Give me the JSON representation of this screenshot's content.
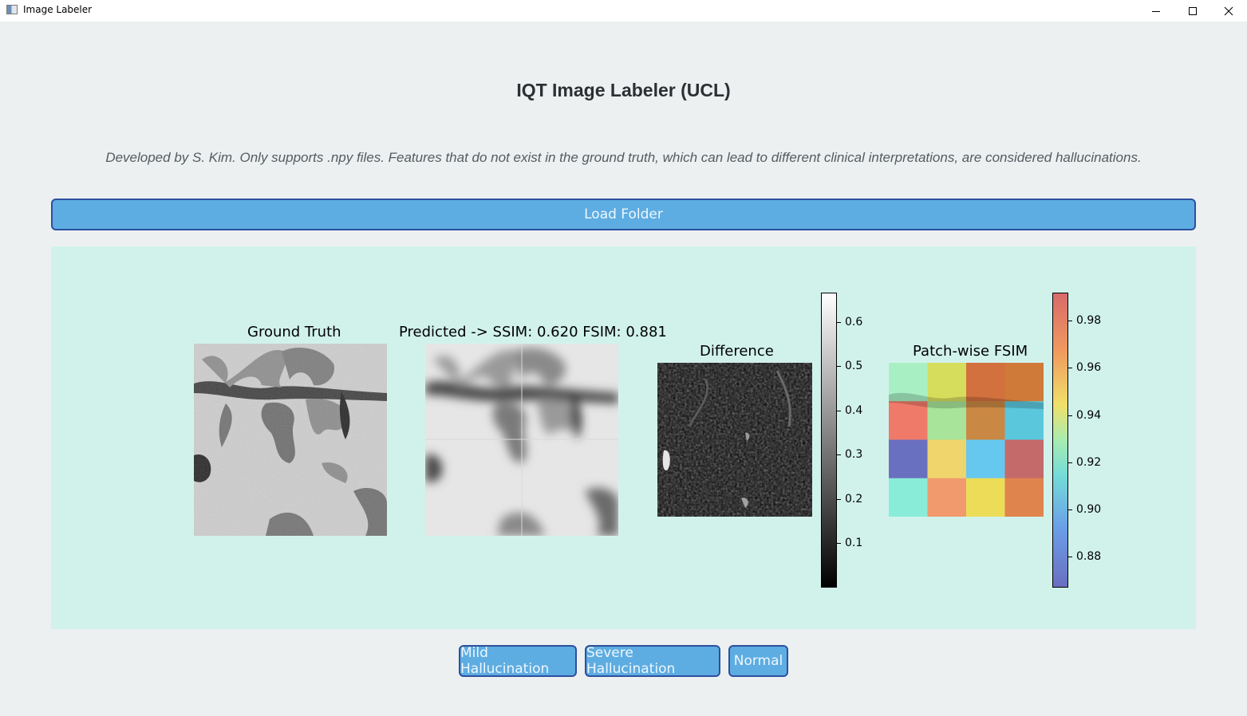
{
  "window": {
    "title": "Image Labeler",
    "controls": [
      "minimize",
      "maximize",
      "close"
    ]
  },
  "header": {
    "title": "IQT Image Labeler (UCL)",
    "subtitle": "Developed by S. Kim. Only supports .npy files. Features that do not exist in the ground truth, which can lead to different clinical interpretations, are considered hallucinations."
  },
  "toolbar": {
    "load_label": "Load Folder"
  },
  "figure": {
    "ground_truth_title": "Ground Truth",
    "predicted_title": "Predicted -> SSIM: 0.620 FSIM: 0.881",
    "difference_title": "Difference",
    "fsim_title": "Patch-wise FSIM",
    "difference_colorbar": {
      "colormap": "gray",
      "ticks": [
        "0.1",
        "0.2",
        "0.3",
        "0.4",
        "0.5",
        "0.6"
      ]
    },
    "fsim_colorbar": {
      "colormap": "coolwarm-like",
      "ticks": [
        "0.88",
        "0.90",
        "0.92",
        "0.94",
        "0.96",
        "0.98"
      ]
    },
    "fsim_patch_colors": [
      [
        "#a8f0c4",
        "#d6dc5c",
        "#d2703e",
        "#d07a3a"
      ],
      [
        "#f07a6a",
        "#a8e49a",
        "#c98844",
        "#5bc7dc"
      ],
      [
        "#6a70c0",
        "#f0d46c",
        "#66c8ee",
        "#c56a6a"
      ],
      [
        "#88ecd8",
        "#f09a6e",
        "#ecdc58",
        "#e0844e"
      ]
    ]
  },
  "actions": {
    "mild_label": "Mild Hallucination",
    "severe_label": "Severe Hallucination",
    "normal_label": "Normal"
  },
  "colors": {
    "background": "#ecf0f1",
    "panel": "#d1f2eb",
    "button": "#5dade2",
    "button_border": "#2e4f9e"
  }
}
